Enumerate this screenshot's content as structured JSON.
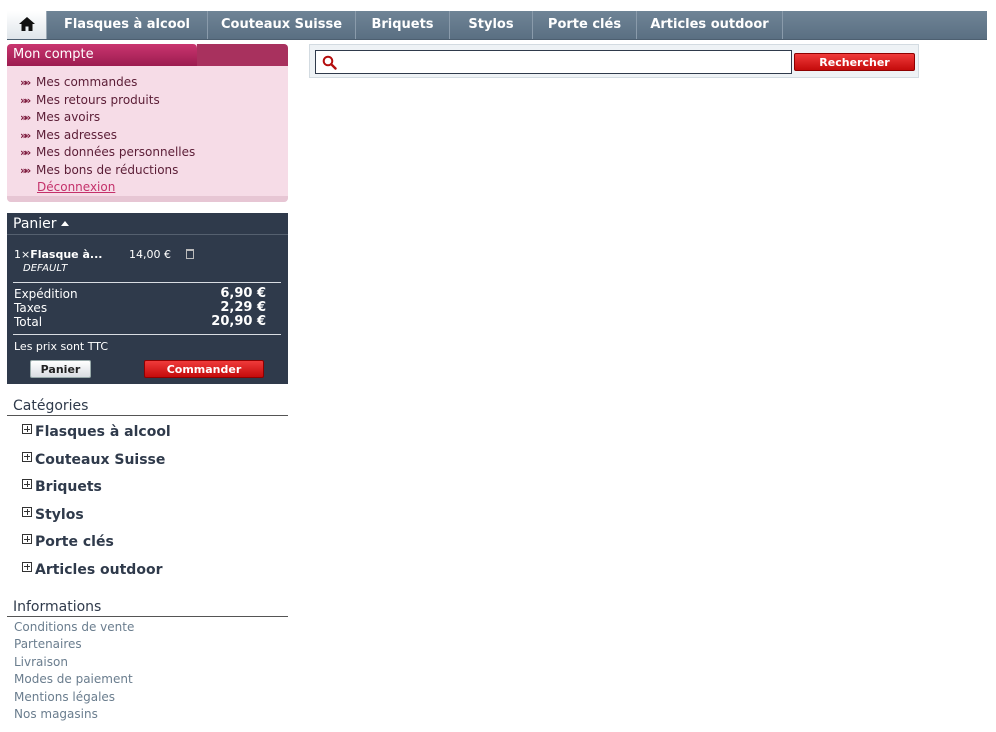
{
  "nav": {
    "items": [
      {
        "label": "Flasques à alcool"
      },
      {
        "label": "Couteaux Suisse"
      },
      {
        "label": "Briquets"
      },
      {
        "label": "Stylos"
      },
      {
        "label": "Porte clés"
      },
      {
        "label": "Articles outdoor"
      }
    ],
    "home_icon": "home-icon"
  },
  "search": {
    "placeholder": "",
    "button_label": "Rechercher",
    "icon": "search-icon"
  },
  "account": {
    "title": "Mon compte",
    "links": [
      "Mes commandes",
      "Mes retours produits",
      "Mes avoirs",
      "Mes adresses",
      "Mes données personnelles",
      "Mes bons de réductions"
    ],
    "logout": "Déconnexion"
  },
  "cart": {
    "title": "Panier",
    "item": {
      "qty": "1×",
      "name": "Flasque à...",
      "price": "14,00 €",
      "variant": "DEFAULT"
    },
    "shipping_label": "Expédition",
    "shipping_value": "6,90 €",
    "tax_label": "Taxes",
    "tax_value": "2,29 €",
    "total_label": "Total",
    "total_value": "20,90 €",
    "ttc_note": "Les prix sont TTC",
    "cart_button": "Panier",
    "checkout_button": "Commander"
  },
  "categories": {
    "title": "Catégories",
    "items": [
      "Flasques à alcool",
      "Couteaux Suisse",
      "Briquets",
      "Stylos",
      "Porte clés",
      "Articles outdoor"
    ]
  },
  "informations": {
    "title": "Informations",
    "items": [
      "Conditions de vente",
      "Partenaires",
      "Livraison",
      "Modes de paiement",
      "Mentions légales",
      "Nos magasins"
    ]
  },
  "colors": {
    "nav_bg": "#5a6f82",
    "account_header": "#9c1c50",
    "account_bg": "#f6dce7",
    "cart_bg": "#2f3a4b",
    "button_red": "#c40b0b"
  }
}
